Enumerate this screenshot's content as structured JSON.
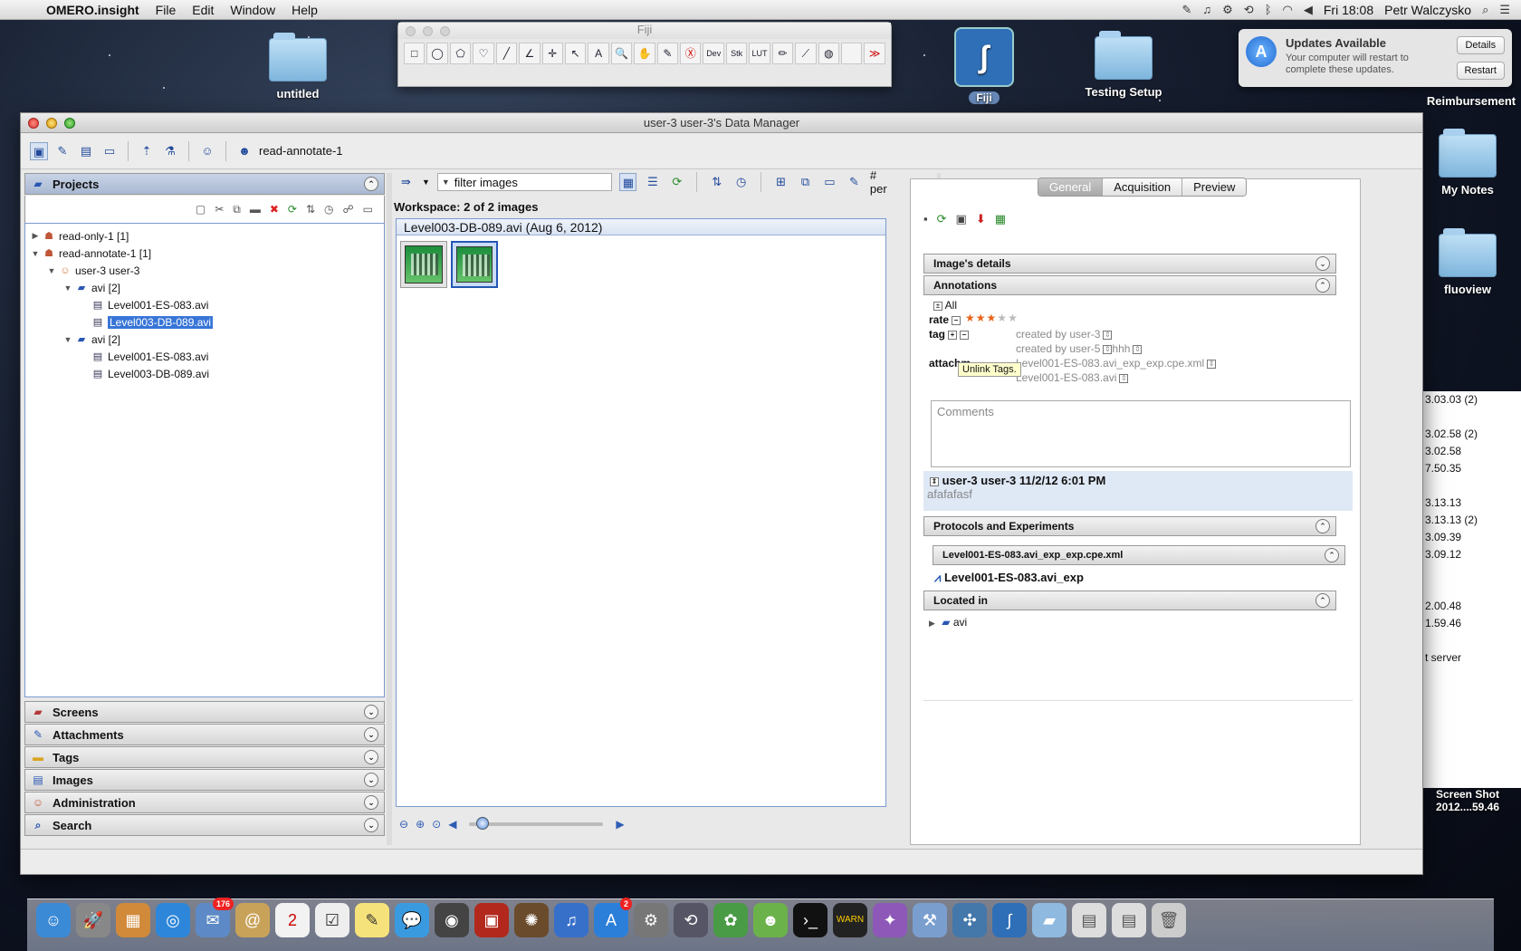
{
  "menubar": {
    "app_name": "OMERO.insight",
    "items": [
      "File",
      "Edit",
      "Window",
      "Help"
    ],
    "clock": "Fri 18:08",
    "user": "Petr Walczysko"
  },
  "desktop": {
    "icons": [
      "untitled",
      "Fiji",
      "Testing Setup",
      "Reimbursement",
      "My Notes",
      "fluoview"
    ],
    "screenshot_label_1": "Screen Shot",
    "screenshot_label_2": "2012....59.46"
  },
  "notification": {
    "title": "Updates Available",
    "message": "Your computer will restart to complete these updates.",
    "details_label": "Details",
    "restart_label": "Restart"
  },
  "fiji": {
    "title": "Fiji",
    "tools": [
      "□",
      "◯",
      "⬠",
      "♡",
      "╱",
      "∠",
      "✛",
      "↖",
      "A",
      "🔍",
      "✋",
      "✎",
      "Ⓧ",
      "Dev",
      "Stk",
      "LUT",
      "✏",
      "⟋",
      "◍",
      "",
      "≫"
    ]
  },
  "window": {
    "title": "user-3 user-3's Data Manager",
    "group_label": "read-annotate-1"
  },
  "left": {
    "projects_header": "Projects",
    "tree": [
      {
        "label": "read-only-1 [1]",
        "indent": 0,
        "toggle": "▶",
        "icon": "group"
      },
      {
        "label": "read-annotate-1 [1]",
        "indent": 0,
        "toggle": "▼",
        "icon": "group"
      },
      {
        "label": "user-3 user-3",
        "indent": 1,
        "toggle": "▼",
        "icon": "user"
      },
      {
        "label": "avi [2]",
        "indent": 2,
        "toggle": "▼",
        "icon": "dataset"
      },
      {
        "label": "Level001-ES-083.avi",
        "indent": 3,
        "toggle": "",
        "icon": "image"
      },
      {
        "label": "Level003-DB-089.avi",
        "indent": 3,
        "toggle": "",
        "icon": "image",
        "selected": true
      },
      {
        "label": "avi [2]",
        "indent": 2,
        "toggle": "▼",
        "icon": "dataset"
      },
      {
        "label": "Level001-ES-083.avi",
        "indent": 3,
        "toggle": "",
        "icon": "image"
      },
      {
        "label": "Level003-DB-089.avi",
        "indent": 3,
        "toggle": "",
        "icon": "image"
      }
    ],
    "sections": [
      "Screens",
      "Attachments",
      "Tags",
      "Images",
      "Administration",
      "Search"
    ]
  },
  "center": {
    "filter_text": "filter  images",
    "per_label": "# per",
    "workspace_label": "Workspace: 2 of 2 images",
    "browser_title": "Level003-DB-089.avi (Aug 6, 2012)"
  },
  "right": {
    "tabs": [
      "General",
      "Acquisition",
      "Preview"
    ],
    "image_details_header": "Image's details",
    "annotations_header": "Annotations",
    "all_label": "All",
    "rate_label": "rate",
    "rating": 3,
    "rating_max": 5,
    "tag_label": "tag",
    "tag_1": "created by user-3",
    "tag_2": "created by user-5",
    "tag_2_value": "hhh",
    "attach_label": "attachm",
    "attachment_1": "Level001-ES-083.avi_exp_exp.cpe.xml",
    "attachment_2": "Level001-ES-083.avi",
    "tooltip": "Unlink Tags.",
    "comments_placeholder": "Comments",
    "comment_author": "user-3 user-3 11/2/12 6:01 PM",
    "comment_text": "afafafasf",
    "protocols_header": "Protocols and Experiments",
    "protocol_file": "Level001-ES-083.avi_exp_exp.cpe.xml",
    "protocol_name": "Level001-ES-083.avi_exp",
    "located_header": "Located in",
    "located_item": "avi"
  },
  "sidewin": {
    "rows": [
      "3.03.03 (2)",
      "",
      "3.02.58 (2)",
      "3.02.58",
      "7.50.35",
      "",
      "3.13.13",
      "3.13.13 (2)",
      "3.09.39",
      "3.09.12",
      "",
      "",
      "2.00.48",
      "1.59.46",
      "",
      "t server"
    ]
  },
  "colors": {
    "selection": "#3875d7",
    "panel_border": "#7b9ad0",
    "rating_on": "#e7641a"
  }
}
